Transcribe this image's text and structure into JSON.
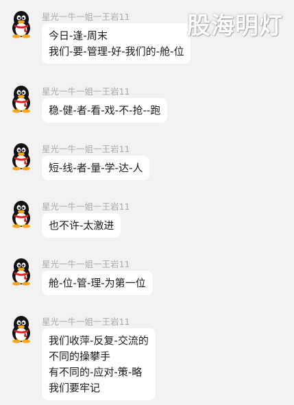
{
  "watermark": "股海明灯",
  "messages": [
    {
      "sender": "星光一牛一姐一王岩11",
      "lines": [
        "今日-逢-周末",
        "我们-要-管理-好-我们的-舱-位"
      ]
    },
    {
      "sender": "星光一牛一姐一王岩11",
      "lines": [
        "稳-健-者-看-戏-不-抢--跑"
      ]
    },
    {
      "sender": "星光一牛一姐一王岩11",
      "lines": [
        "短-线-者-量-学-达-人"
      ]
    },
    {
      "sender": "星光一牛一姐一王岩11",
      "lines": [
        "也不许-太激进"
      ]
    },
    {
      "sender": "星光一牛一姐一王岩11",
      "lines": [
        "舱-位-管-理-为第一位"
      ]
    },
    {
      "sender": "星光一牛一姐一王岩11",
      "lines": [
        "我们收萍-反复-交流的",
        "不同的操攀手",
        "有不同的-应对-策-略",
        "我们要牢记"
      ]
    }
  ],
  "colors": {
    "background": "#f2f2f2",
    "bubble": "#ffffff",
    "sender": "#a9a9a9",
    "text": "#1a1a1a"
  },
  "icons": {
    "avatar": "qq-penguin-icon"
  }
}
